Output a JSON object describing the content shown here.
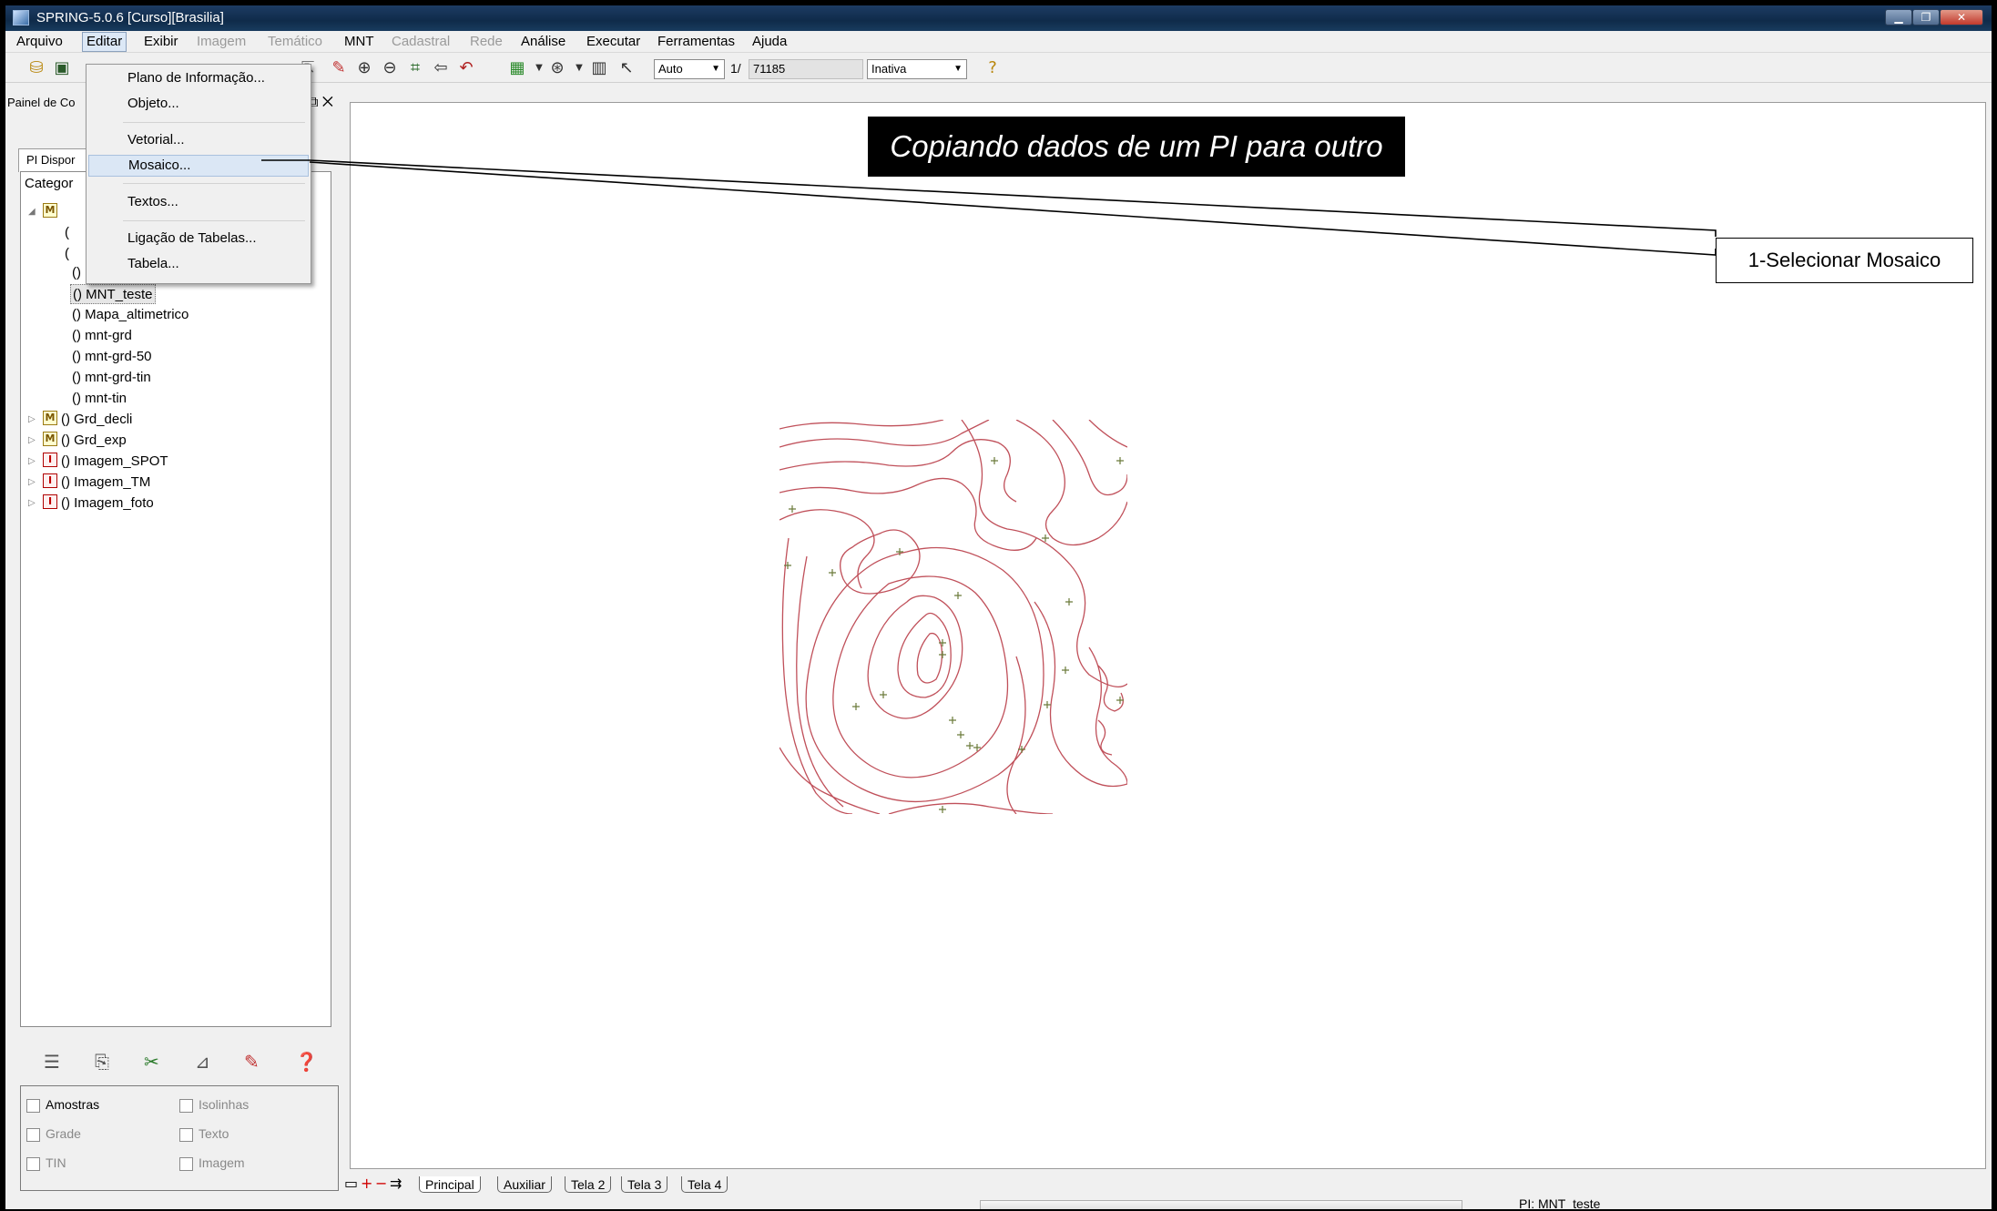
{
  "window": {
    "title": "SPRING-5.0.6 [Curso][Brasilia]"
  },
  "menu": {
    "items": [
      {
        "label": "Arquivo",
        "enabled": true
      },
      {
        "label": "Editar",
        "enabled": true,
        "active": true
      },
      {
        "label": "Exibir",
        "enabled": true
      },
      {
        "label": "Imagem",
        "enabled": false
      },
      {
        "label": "Temático",
        "enabled": false
      },
      {
        "label": "MNT",
        "enabled": true
      },
      {
        "label": "Cadastral",
        "enabled": false
      },
      {
        "label": "Rede",
        "enabled": false
      },
      {
        "label": "Análise",
        "enabled": true
      },
      {
        "label": "Executar",
        "enabled": true
      },
      {
        "label": "Ferramentas",
        "enabled": true
      },
      {
        "label": "Ajuda",
        "enabled": true
      }
    ]
  },
  "edit_menu": {
    "items": [
      "Plano de Informação...",
      "Objeto...",
      "Vetorial...",
      "Mosaico...",
      "Textos...",
      "Ligação de Tabelas...",
      "Tabela..."
    ],
    "highlighted": "Mosaico..."
  },
  "toolbar": {
    "zoom_mode": "Auto",
    "scale_prefix": "1/",
    "scale_value": "71185",
    "cursor_mode": "Inativa",
    "icons": [
      "database-icon",
      "image-icon",
      "pencil-icon",
      "zoom-in-icon",
      "zoom-out-icon",
      "zoom-area-icon",
      "back-arrow-icon",
      "undo-icon",
      "color-palette-icon",
      "cursor-info-icon",
      "grid-icon",
      "pointer-icon",
      "help-icon"
    ]
  },
  "panel": {
    "title": "Painel de Co",
    "tab_label": "PI Dispor",
    "tree_header": "Categor",
    "tree_items": [
      {
        "label": "() MNT_brk",
        "level": 1
      },
      {
        "label": "() MNT_teste",
        "level": 1,
        "selected": true
      },
      {
        "label": "() Mapa_altimetrico",
        "level": 1
      },
      {
        "label": "() mnt-grd",
        "level": 1
      },
      {
        "label": "() mnt-grd-50",
        "level": 1
      },
      {
        "label": "() mnt-grd-tin",
        "level": 1
      },
      {
        "label": "() mnt-tin",
        "level": 1
      },
      {
        "label": "() Grd_decli",
        "level": 0,
        "category": "M"
      },
      {
        "label": "() Grd_exp",
        "level": 0,
        "category": "M"
      },
      {
        "label": "() Imagem_SPOT",
        "level": 0,
        "category": "I"
      },
      {
        "label": "() Imagem_TM",
        "level": 0,
        "category": "I"
      },
      {
        "label": "() Imagem_foto",
        "level": 0,
        "category": "I"
      }
    ],
    "checkboxes": [
      {
        "label": "Amostras",
        "enabled": true
      },
      {
        "label": "Isolinhas",
        "enabled": false
      },
      {
        "label": "Grade",
        "enabled": false
      },
      {
        "label": "Texto",
        "enabled": false
      },
      {
        "label": "TIN",
        "enabled": false
      },
      {
        "label": "Imagem",
        "enabled": false
      }
    ]
  },
  "annotations": {
    "banner": "Copiando dados de um PI para outro",
    "callout": "1-Selecionar Mosaico"
  },
  "tabs": [
    "Principal",
    "Auxiliar",
    "Tela 2",
    "Tela 3",
    "Tela 4"
  ],
  "active_tab": "Principal",
  "status": {
    "pi": "PI: MNT_teste"
  },
  "colors": {
    "contour": "#c0505a",
    "sample_point": "#6b7a3a",
    "titlebar": "#1d3c63"
  }
}
